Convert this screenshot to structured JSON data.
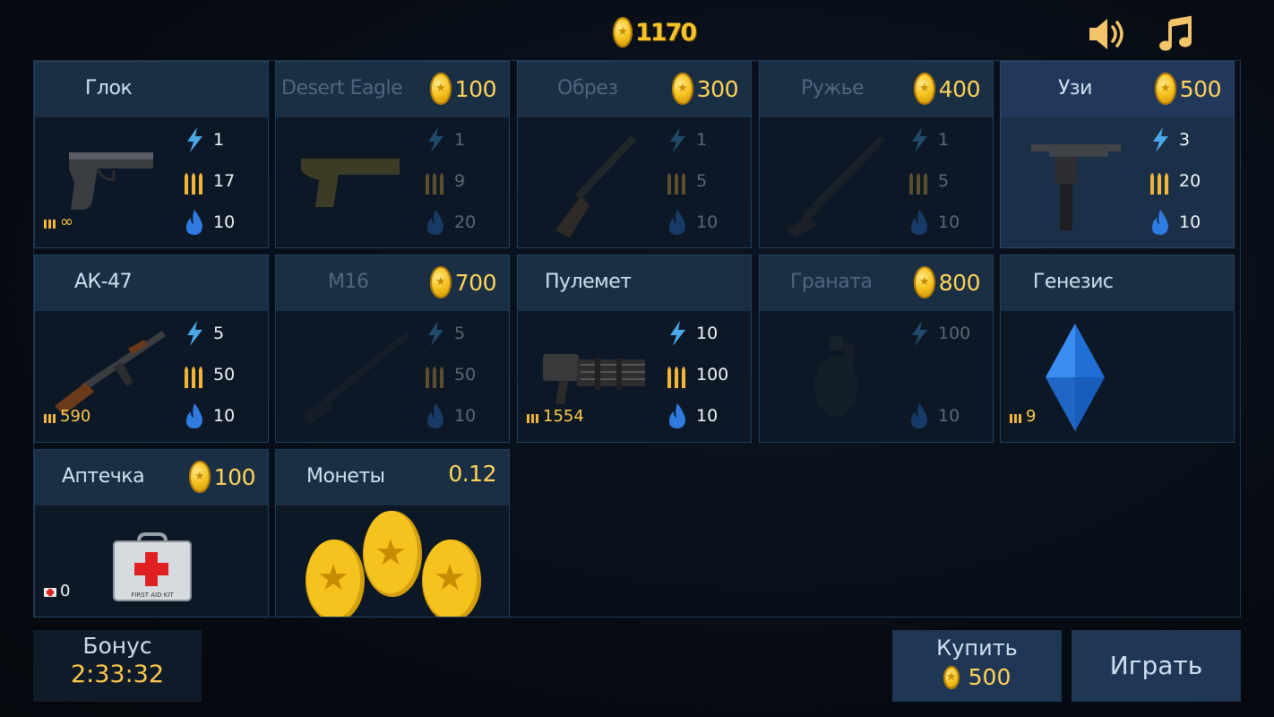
{
  "header": {
    "coins": "1170",
    "sound_icon": "speaker-icon",
    "music_icon": "music-note-icon"
  },
  "items": [
    {
      "id": "glock",
      "name": "Глок",
      "price": "",
      "locked": false,
      "selected": false,
      "damage": "1",
      "clip": "17",
      "fire": "10",
      "ammo": "∞"
    },
    {
      "id": "deagle",
      "name": "Desert Eagle",
      "price": "100",
      "locked": true,
      "selected": false,
      "damage": "1",
      "clip": "9",
      "fire": "20",
      "ammo": ""
    },
    {
      "id": "sawedoff",
      "name": "Обрез",
      "price": "300",
      "locked": true,
      "selected": false,
      "damage": "1",
      "clip": "5",
      "fire": "10",
      "ammo": ""
    },
    {
      "id": "shotgun",
      "name": "Ружье",
      "price": "400",
      "locked": true,
      "selected": false,
      "damage": "1",
      "clip": "5",
      "fire": "10",
      "ammo": ""
    },
    {
      "id": "uzi",
      "name": "Узи",
      "price": "500",
      "locked": false,
      "selected": true,
      "damage": "3",
      "clip": "20",
      "fire": "10",
      "ammo": ""
    },
    {
      "id": "ak47",
      "name": "АК-47",
      "price": "",
      "locked": false,
      "selected": false,
      "damage": "5",
      "clip": "50",
      "fire": "10",
      "ammo": "590"
    },
    {
      "id": "m16",
      "name": "М16",
      "price": "700",
      "locked": true,
      "selected": false,
      "damage": "5",
      "clip": "50",
      "fire": "10",
      "ammo": ""
    },
    {
      "id": "minigun",
      "name": "Пулемет",
      "price": "",
      "locked": false,
      "selected": false,
      "damage": "10",
      "clip": "100",
      "fire": "10",
      "ammo": "1554"
    },
    {
      "id": "grenade",
      "name": "Граната",
      "price": "800",
      "locked": true,
      "selected": false,
      "damage": "100",
      "clip": "",
      "fire": "10",
      "ammo": ""
    },
    {
      "id": "genesis",
      "name": "Генезис",
      "price": "",
      "locked": false,
      "selected": false,
      "damage": "",
      "clip": "",
      "fire": "",
      "ammo": "9"
    },
    {
      "id": "medkit",
      "name": "Аптечка",
      "price": "100",
      "locked": false,
      "selected": false,
      "damage": "",
      "clip": "",
      "fire": "",
      "ammo": "0",
      "art_text": "FIRST AID KIT"
    },
    {
      "id": "coins",
      "name": "Монеты",
      "price": "0.12",
      "locked": false,
      "selected": false,
      "damage": "",
      "clip": "",
      "fire": "",
      "ammo": ""
    }
  ],
  "bonus": {
    "label": "Бонус",
    "timer": "2:33:32"
  },
  "buy": {
    "label": "Купить",
    "price": "500"
  },
  "play": {
    "label": "Играть"
  },
  "colors": {
    "accent_gold": "#f6c22a",
    "panel": "#1a2e44",
    "selected": "#22385a",
    "lightning": "#4aa8e8",
    "fire": "#2f7be0"
  }
}
